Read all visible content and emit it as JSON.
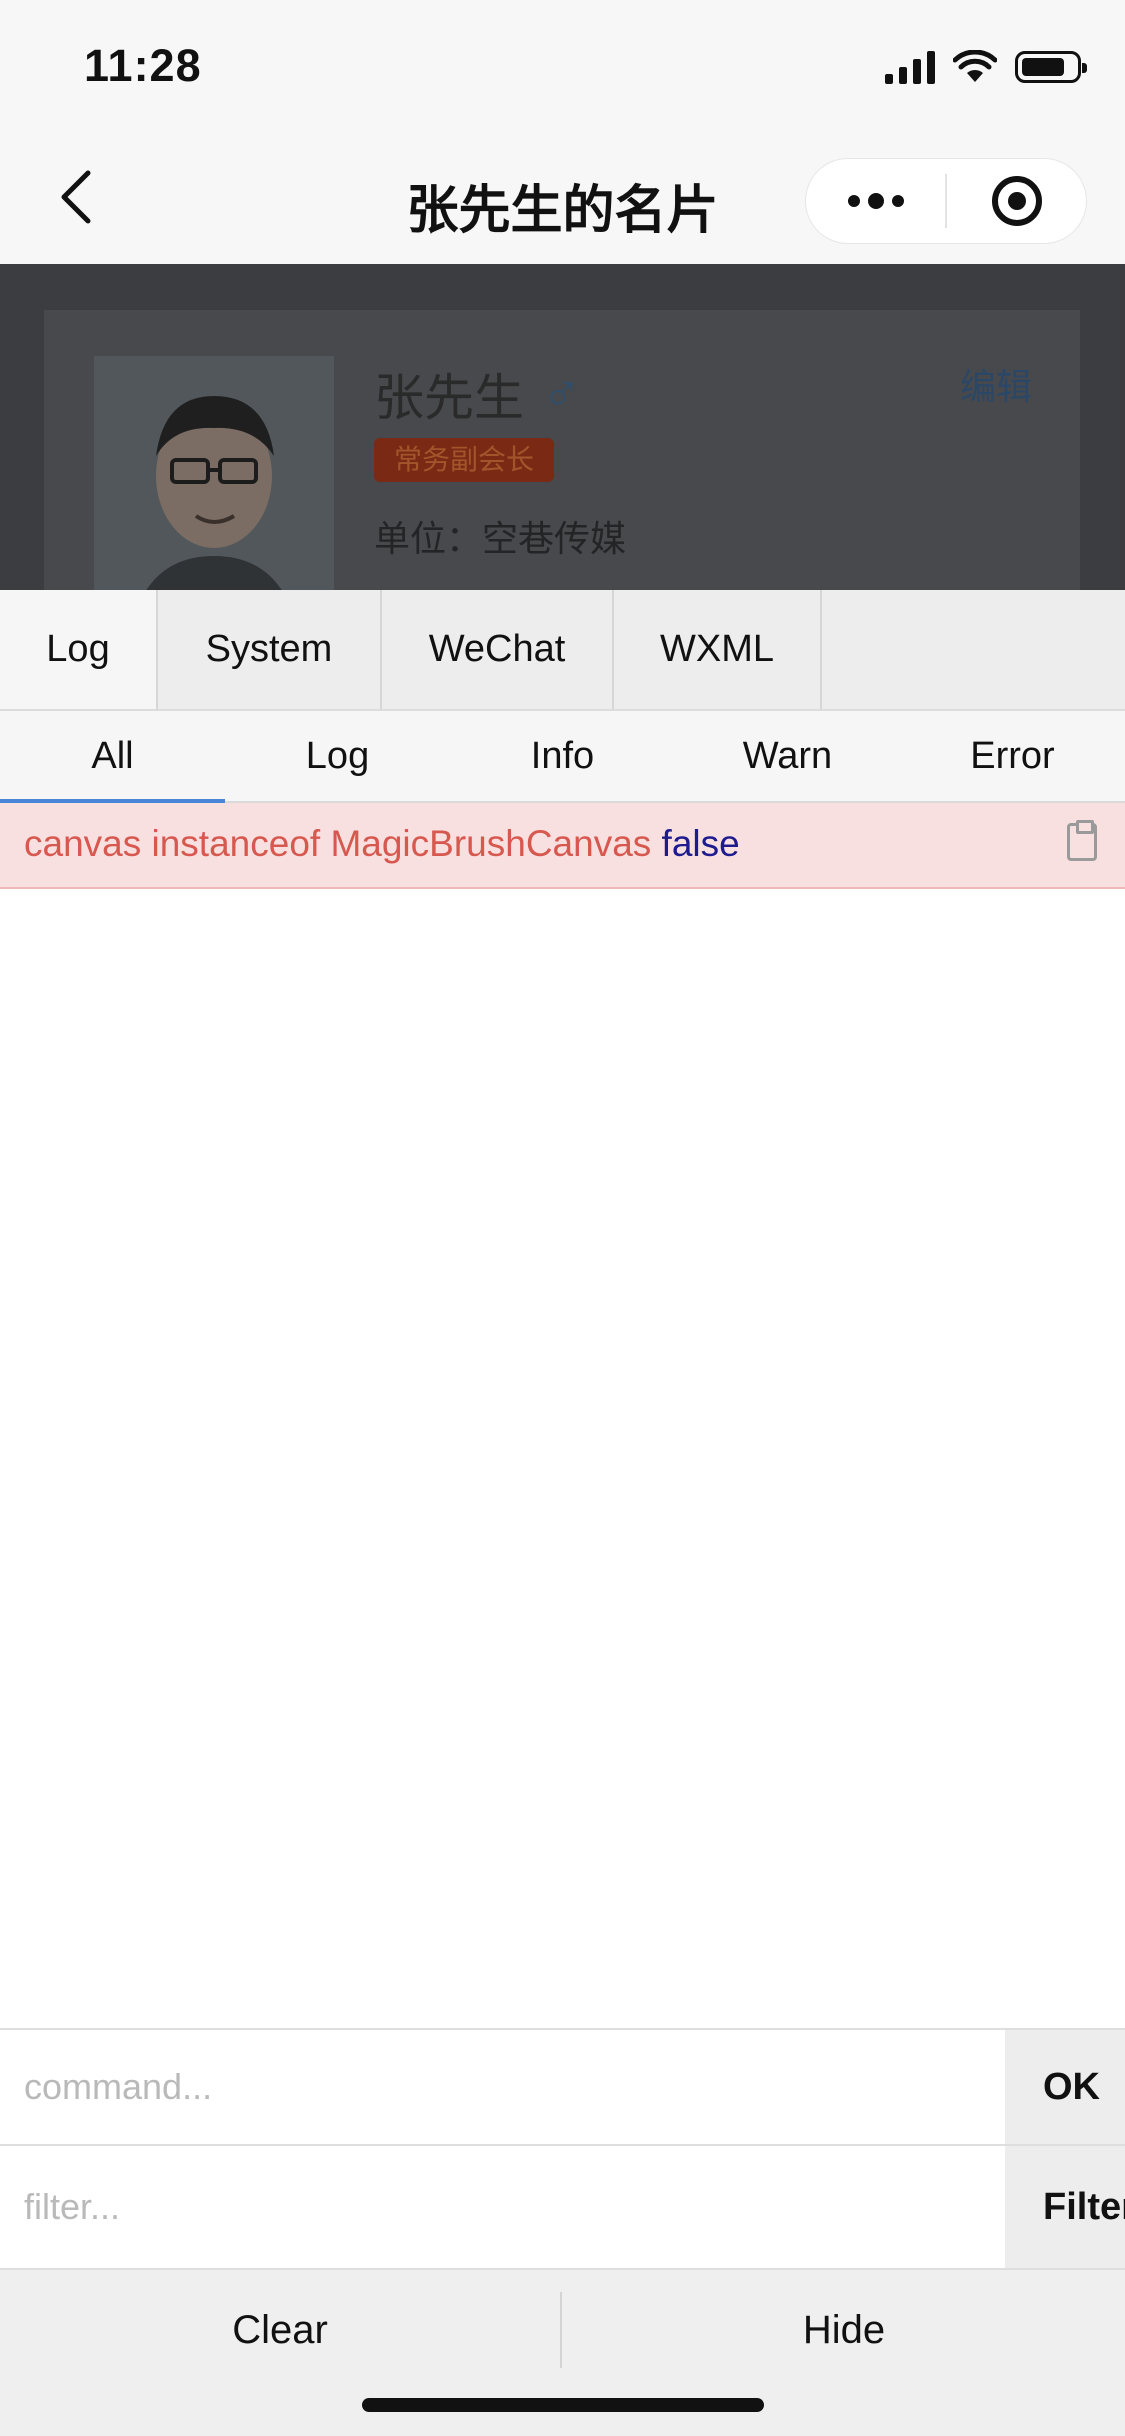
{
  "status_bar": {
    "time": "11:28"
  },
  "nav": {
    "title": "张先生的名片"
  },
  "card": {
    "name": "张先生",
    "gender_symbol": "♂",
    "title_badge": "常务副会长",
    "company": "单位：空巷传媒",
    "edit_label": "编辑"
  },
  "vconsole": {
    "tabs": [
      "Log",
      "System",
      "WeChat",
      "WXML"
    ],
    "active_tab": "Log",
    "sub_tabs": [
      "All",
      "Log",
      "Info",
      "Warn",
      "Error"
    ],
    "active_sub_tab": "All",
    "log_entries": [
      {
        "text": "canvas instanceof MagicBrushCanvas",
        "value": "false",
        "level": "error"
      }
    ],
    "command_placeholder": "command...",
    "command_button": "OK",
    "filter_placeholder": "filter...",
    "filter_button": "Filter",
    "clear_label": "Clear",
    "hide_label": "Hide"
  },
  "colors": {
    "error_text": "#d7584f",
    "error_bg": "#f9e0e0",
    "bool_value": "#1e1b8f",
    "active_underline": "#4a86d8"
  }
}
